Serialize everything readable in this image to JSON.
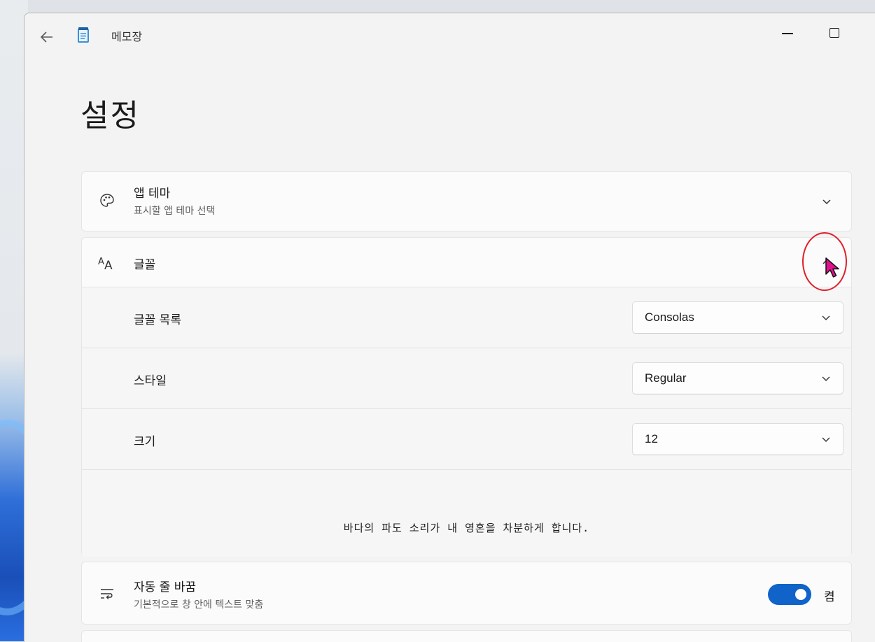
{
  "window": {
    "app_title": "메모장",
    "back_icon": "back-arrow-icon",
    "minimize_icon": "minimize-icon",
    "maximize_icon": "maximize-icon"
  },
  "page": {
    "title": "설정"
  },
  "app_theme": {
    "icon": "palette-icon",
    "title": "앱 테마",
    "subtitle": "표시할 앱 테마 선택",
    "expanded": false
  },
  "font": {
    "icon": "font-icon",
    "title": "글꼴",
    "expanded": true,
    "rows": [
      {
        "label": "글꼴 목록",
        "value": "Consolas"
      },
      {
        "label": "스타일",
        "value": "Regular"
      },
      {
        "label": "크기",
        "value": "12"
      }
    ],
    "preview_text": "바다의 파도 소리가 내 영혼을 차분하게 합니다."
  },
  "word_wrap": {
    "icon": "word-wrap-icon",
    "title": "자동 줄 바꿈",
    "subtitle": "기본적으로 창 안에 텍스트 맞춤",
    "toggle_on": true,
    "toggle_label": "켬"
  },
  "colors": {
    "accent": "#0f63c9",
    "highlight_ring": "#e0202a",
    "cursor": "#e0108c"
  }
}
